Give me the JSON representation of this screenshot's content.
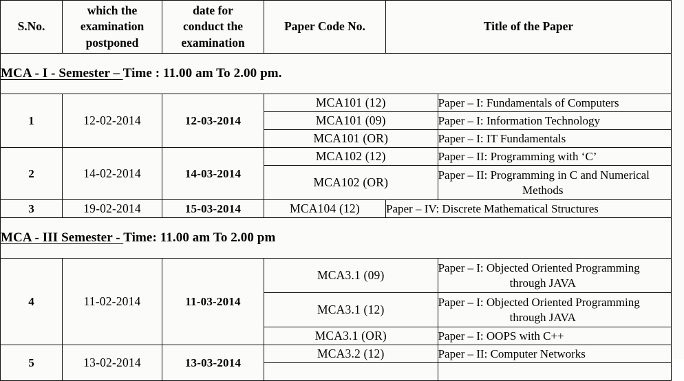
{
  "document": {
    "kind": "examination-timetable",
    "table_headers": {
      "sno": "S.No.",
      "postponed_line1": "which the",
      "postponed_line2": "examination",
      "postponed_line3": "postponed",
      "newdate_line1": "date for",
      "newdate_line2": "conduct the",
      "newdate_line3": "examination",
      "paper_code": "Paper Code No.",
      "paper_title": "Title of the Paper"
    },
    "sections": [
      {
        "id": "mca-i",
        "underlined": "MCA - I -  Semester – ",
        "plain": "Time : 11.00 am To 2.00 pm.",
        "rows": [
          {
            "sno": "1",
            "old_date": "12-02-2014",
            "new_date": "12-03-2014",
            "papers": [
              {
                "code": "MCA101 (12)",
                "title": "Paper – I: Fundamentals of Computers",
                "title2": ""
              },
              {
                "code": "MCA101 (09)",
                "title": "Paper – I: Information Technology",
                "title2": ""
              },
              {
                "code": "MCA101 (OR)",
                "title": "Paper – I: IT Fundamentals",
                "title2": ""
              }
            ]
          },
          {
            "sno": "2",
            "old_date": "14-02-2014",
            "new_date": "14-03-2014",
            "papers": [
              {
                "code": "MCA102 (12)",
                "title": "Paper – II: Programming with ‘C’",
                "title2": ""
              },
              {
                "code": "MCA102 (OR)",
                "title": "Paper – II: Programming in C and Numerical",
                "title2": "Methods"
              }
            ]
          },
          {
            "sno": "3",
            "old_date": "19-02-2014",
            "new_date": "15-03-2014",
            "papers": [
              {
                "code": "MCA104 (12)",
                "title": "Paper – IV: Discrete Mathematical Structures",
                "title2": ""
              }
            ]
          }
        ]
      },
      {
        "id": "mca-iii",
        "underlined": "MCA - III   Semester - ",
        "plain": " Time: 11.00 am To 2.00 pm",
        "rows": [
          {
            "sno": "4",
            "old_date": "11-02-2014",
            "new_date": "11-03-2014",
            "papers": [
              {
                "code": "MCA3.1 (09)",
                "title": "Paper – I: Objected Oriented Programming",
                "title2": "through JAVA"
              },
              {
                "code": "MCA3.1 (12)",
                "title": "Paper – I: Objected Oriented Programming",
                "title2": "through JAVA"
              },
              {
                "code": "MCA3.1 (OR)",
                "title": "Paper – I: OOPS with C++",
                "title2": ""
              }
            ]
          },
          {
            "sno": "5",
            "old_date": "13-02-2014",
            "new_date": "13-03-2014",
            "papers": [
              {
                "code": "MCA3.2 (12)",
                "title": "Paper – II: Computer Networks",
                "title2": ""
              },
              {
                "code": "",
                "title": "",
                "title2": ""
              }
            ]
          }
        ]
      }
    ]
  }
}
